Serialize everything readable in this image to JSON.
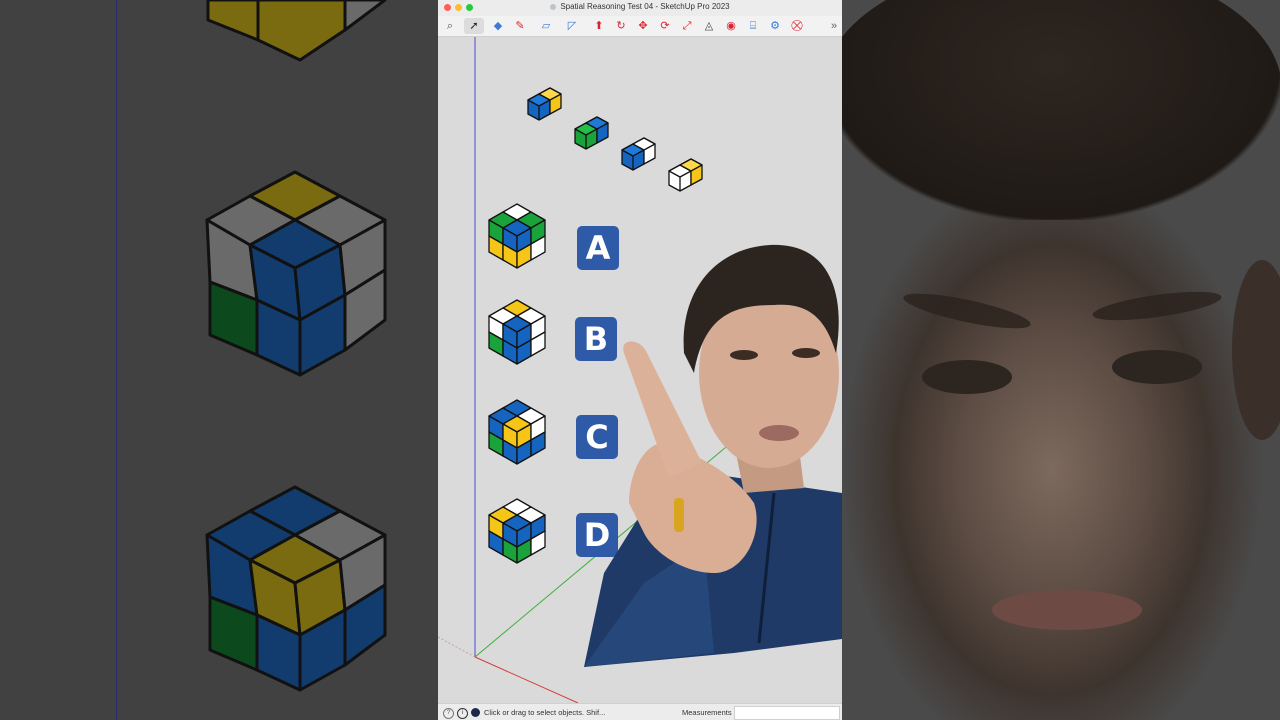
{
  "window": {
    "title": "Spatial Reasoning Test 04 - SketchUp Pro 2023"
  },
  "toolbar": {
    "tools": [
      {
        "name": "search-icon",
        "glyph": "⌕"
      },
      {
        "name": "select-arrow-icon",
        "glyph": "➚"
      },
      {
        "name": "eraser-icon",
        "glyph": "◆"
      },
      {
        "name": "pencil-icon",
        "glyph": "✎"
      },
      {
        "name": "shape-icon",
        "glyph": "▱"
      },
      {
        "name": "rectangle-icon",
        "glyph": "◸"
      },
      {
        "name": "push-pull-icon",
        "glyph": "⬆"
      },
      {
        "name": "follow-me-icon",
        "glyph": "↻"
      },
      {
        "name": "move-icon",
        "glyph": "✥"
      },
      {
        "name": "rotate-icon",
        "glyph": "⟳"
      },
      {
        "name": "scale-icon",
        "glyph": "⤢"
      },
      {
        "name": "tape-measure-icon",
        "glyph": "◬"
      },
      {
        "name": "paint-bucket-icon",
        "glyph": "◉"
      },
      {
        "name": "text-icon",
        "glyph": "⌸"
      },
      {
        "name": "section-icon",
        "glyph": "⚙"
      },
      {
        "name": "warehouse-icon",
        "glyph": "⛒"
      },
      {
        "name": "overflow-chevron-icon",
        "glyph": "»"
      }
    ]
  },
  "options": {
    "a": "A",
    "b": "B",
    "c": "C",
    "d": "D"
  },
  "status": {
    "hint": "Click or drag to select objects. Shif...",
    "measurements_label": "Measurements",
    "measurements_value": ""
  },
  "colors": {
    "blue": "#1565c0",
    "yellow": "#f5c518",
    "green": "#1aa33a",
    "white": "#ffffff",
    "badge": "#2e5aa8"
  }
}
